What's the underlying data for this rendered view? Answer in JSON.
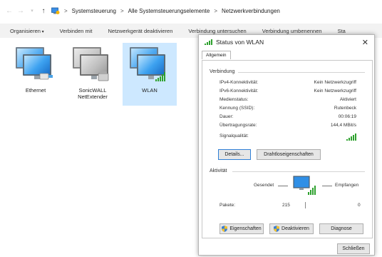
{
  "breadcrumb": {
    "items": [
      "Systemsteuerung",
      "Alle Systemsteuerungselemente",
      "Netzwerkverbindungen"
    ]
  },
  "toolbar": {
    "items": [
      "Organisieren",
      "Verbinden mit",
      "Netzwerkgerät deaktivieren",
      "Verbindung untersuchen",
      "Verbindung umbenennen",
      "Sta"
    ]
  },
  "files": [
    {
      "label": "Ethernet"
    },
    {
      "label": "SonicWALL NetExtender"
    },
    {
      "label": "WLAN"
    }
  ],
  "dialog": {
    "title": "Status von WLAN",
    "tab": "Allgemein",
    "connection_title": "Verbindung",
    "rows": [
      {
        "label": "IPv4-Konnektivität:",
        "value": "Kein Netzwerkzugriff"
      },
      {
        "label": "IPv6-Konnektivität:",
        "value": "Kein Netzwerkzugriff"
      },
      {
        "label": "Medienstatus:",
        "value": "Aktiviert"
      },
      {
        "label": "Kennung (SSID):",
        "value": "Rutenbeck"
      },
      {
        "label": "Dauer:",
        "value": "00:06:19"
      },
      {
        "label": "Übertragungsrate:",
        "value": "144,4 MBit/s"
      }
    ],
    "signal_label": "Signalqualität:",
    "details_button": "Details...",
    "wireless_props_button": "Drahtloseigenschaften",
    "activity_title": "Aktivität",
    "sent_label": "Gesendet",
    "received_label": "Empfangen",
    "packets_label": "Pakete:",
    "packets_sent": "215",
    "packets_received": "0",
    "properties_button": "Eigenschaften",
    "disable_button": "Deaktivieren",
    "diagnose_button": "Diagnose",
    "close_button": "Schließen"
  },
  "colors": {
    "selected_bg": "#cde8ff",
    "signal_green": "#2ea12e",
    "toolbar_bg": "#f2f2f2"
  }
}
